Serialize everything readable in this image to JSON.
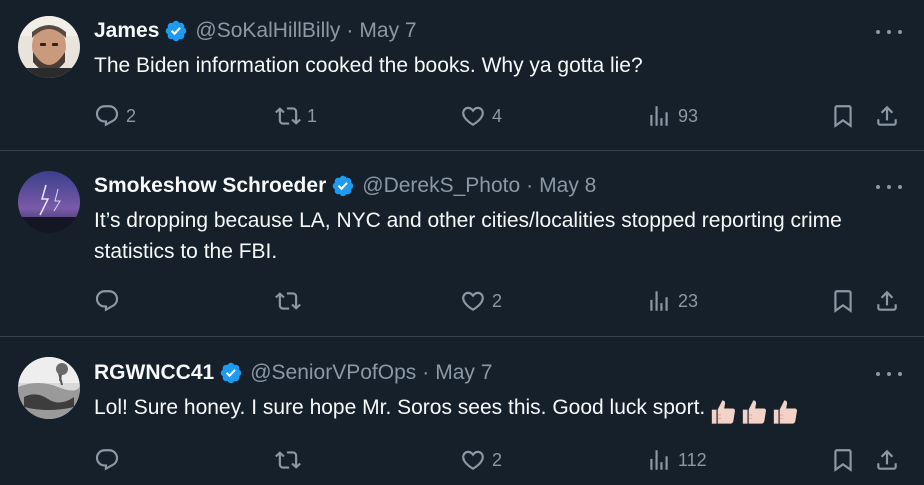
{
  "tweets": [
    {
      "name": "James",
      "handle": "@SoKalHillBilly",
      "separator": "·",
      "date": "May 7",
      "text": "The Biden information cooked the books. Why ya gotta lie?",
      "emoji": "",
      "avatar_icon": "person-photo",
      "counts": {
        "replies": "2",
        "retweets": "1",
        "likes": "4",
        "views": "93"
      }
    },
    {
      "name": "Smokeshow Schroeder",
      "handle": "@DerekS_Photo",
      "separator": "·",
      "date": "May 8",
      "text": "It’s dropping because LA, NYC and other cities/localities stopped reporting crime statistics to the FBI.",
      "emoji": "",
      "avatar_icon": "lightning-photo",
      "counts": {
        "replies": "",
        "retweets": "",
        "likes": "2",
        "views": "23"
      }
    },
    {
      "name": "RGWNCC41",
      "handle": "@SeniorVPofOps",
      "separator": "·",
      "date": "May 7",
      "text": "Lol! Sure honey. I sure hope Mr. Soros sees this. Good luck sport.",
      "emoji": "👍🏻👍🏻👍🏻",
      "avatar_icon": "landscape-photo",
      "counts": {
        "replies": "",
        "retweets": "",
        "likes": "2",
        "views": "112"
      }
    }
  ],
  "colors": {
    "background": "#15202b",
    "divider": "#38444d",
    "text_primary": "#f7f9f9",
    "text_secondary": "#8b98a5",
    "verified_badge": "#1d9bf0"
  },
  "icons": [
    "verified-badge-icon",
    "more-icon",
    "reply-icon",
    "retweet-icon",
    "like-icon",
    "views-icon",
    "bookmark-icon",
    "share-icon",
    "thumbs-up-icon"
  ]
}
